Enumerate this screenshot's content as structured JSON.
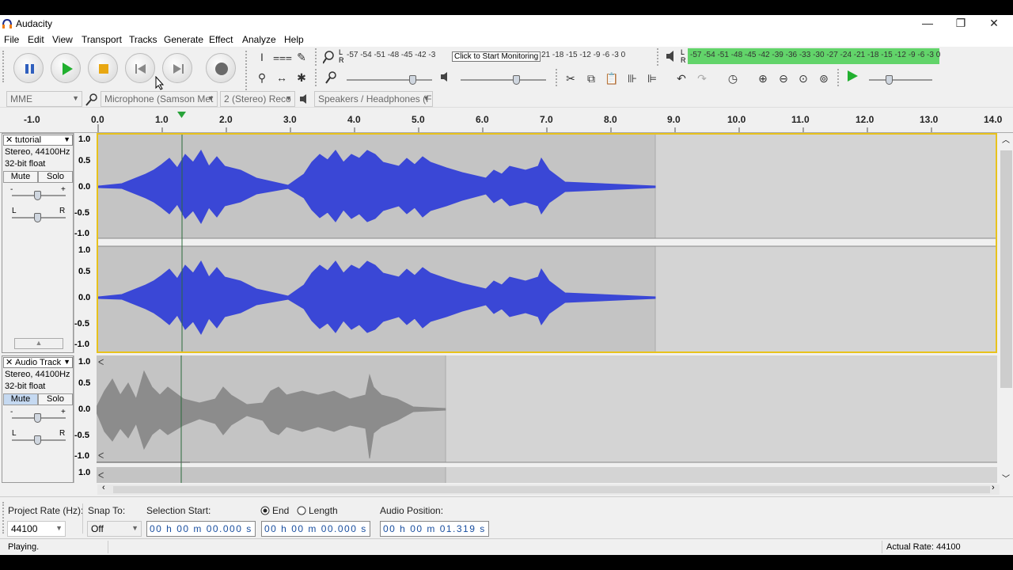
{
  "window": {
    "title": "Audacity",
    "minimize": "—",
    "restore": "❐",
    "close": "✕"
  },
  "menu": [
    "File",
    "Edit",
    "View",
    "Transport",
    "Tracks",
    "Generate",
    "Effect",
    "Analyze",
    "Help"
  ],
  "meters": {
    "record_scale": "-57 -54 -51 -48 -45 -42 -3",
    "record_tooltip": "Click to Start Monitoring",
    "record_scale_right": "21 -18 -15 -12 -9 -6 -3 0",
    "play_scale": "-57 -54 -51 -48 -45 -42 -39 -36 -33 -30 -27 -24 -21 -18 -15 -12 -9 -6 -3 0",
    "lr_top": "L",
    "lr_bottom": "R"
  },
  "devices": {
    "host": "MME",
    "mic": "Microphone (Samson Met",
    "channels": "2 (Stereo) Reco",
    "speakers": "Speakers / Headphones (F"
  },
  "ruler": {
    "ticks": [
      "-1.0",
      "0.0",
      "1.0",
      "2.0",
      "3.0",
      "4.0",
      "5.0",
      "6.0",
      "7.0",
      "8.0",
      "9.0",
      "10.0",
      "11.0",
      "12.0",
      "13.0",
      "14.0"
    ]
  },
  "tracks": [
    {
      "name": "tutorial",
      "info1": "Stereo, 44100Hz",
      "info2": "32-bit float",
      "mute": "Mute",
      "solo": "Solo",
      "scale": [
        "1.0",
        "0.5",
        "0.0",
        "-0.5",
        "-1.0"
      ],
      "slider_minus": "-",
      "slider_plus": "+",
      "pan_l": "L",
      "pan_r": "R"
    },
    {
      "name": "Audio Track",
      "info1": "Stereo, 44100Hz",
      "info2": "32-bit float",
      "mute": "Mute",
      "solo": "Solo",
      "scale": [
        "1.0",
        "0.5",
        "0.0",
        "-0.5",
        "-1.0",
        "1.0"
      ],
      "slider_minus": "-",
      "slider_plus": "+",
      "pan_l": "L",
      "pan_r": "R"
    }
  ],
  "selection": {
    "project_rate_label": "Project Rate (Hz):",
    "project_rate": "44100",
    "snap_label": "Snap To:",
    "snap_value": "Off",
    "sel_start_label": "Selection Start:",
    "end_label": "End",
    "length_label": "Length",
    "sel_start": "00 h 00 m 00.000 s",
    "sel_end": "00 h 00 m 00.000 s",
    "audio_pos_label": "Audio Position:",
    "audio_pos": "00 h 00 m 01.319 s"
  },
  "status": {
    "left": "Playing.",
    "right": "Actual Rate: 44100"
  },
  "colors": {
    "wave_blue": "#3a47d6",
    "wave_gray": "#8c8c8c",
    "selected_bg": "#c4c4c4",
    "unselected_bg": "#d4d4d4",
    "meter_green": "#62d46a"
  }
}
